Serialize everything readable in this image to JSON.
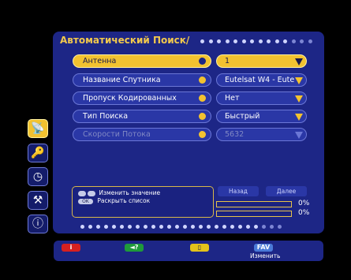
{
  "menu": {
    "title": "Автоматический Поиск/",
    "rows": [
      {
        "label": "Антенна",
        "value": "1",
        "state": "selected"
      },
      {
        "label": "Название Спутника",
        "value": "Eutelsat W4 - Eute",
        "state": "normal"
      },
      {
        "label": "Пропуск Кодированных",
        "value": "Нет",
        "state": "normal"
      },
      {
        "label": "Тип Поиска",
        "value": "Быстрый",
        "state": "normal"
      },
      {
        "label": "Скорости Потока",
        "value": "5632",
        "state": "disabled"
      }
    ]
  },
  "side_icons": [
    "satellite-dish-icon",
    "key-icon",
    "clock-icon",
    "tools-icon",
    "info-icon"
  ],
  "help": {
    "line1": "Изменить значение",
    "ok_key": "OK",
    "line2": "Раскрыть список"
  },
  "nav": {
    "back": "Назад",
    "next": "Далее"
  },
  "progress": [
    {
      "text": "0%",
      "value": 0
    },
    {
      "text": "0%",
      "value": 0
    }
  ],
  "footer": {
    "red_key": "i",
    "green_key": "◄?",
    "fav_key": "FAV",
    "fav_caption": "Изменить"
  },
  "colors": {
    "panel": "#1d2686",
    "accent": "#f2c230",
    "red": "#d62020",
    "green": "#1f9a3a",
    "yellow": "#e3c21a",
    "blue": "#4a7ad8"
  }
}
